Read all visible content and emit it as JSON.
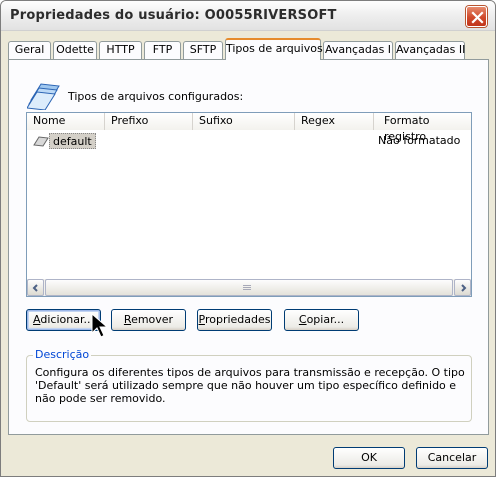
{
  "window": {
    "title": "Propriedades do usuário: O0055RIVERSOFT"
  },
  "tabs": [
    {
      "label": "Geral"
    },
    {
      "label": "Odette"
    },
    {
      "label": "HTTP"
    },
    {
      "label": "FTP"
    },
    {
      "label": "SFTP"
    },
    {
      "label": "Tipos de arquivos"
    },
    {
      "label": "Avançadas I"
    },
    {
      "label": "Avançadas II"
    }
  ],
  "active_tab": "Tipos de arquivos",
  "panel": {
    "header_label": "Tipos de arquivos configurados:",
    "columns": [
      {
        "label": "Nome"
      },
      {
        "label": "Prefixo"
      },
      {
        "label": "Sufixo"
      },
      {
        "label": "Regex"
      },
      {
        "label": "Formato registro"
      }
    ],
    "rows": [
      {
        "name": "default",
        "prefix": "",
        "suffix": "",
        "regex": "",
        "format": "Não formatado"
      }
    ],
    "buttons": {
      "add": {
        "accel": "A",
        "rest": "dicionar..."
      },
      "remove": {
        "accel": "R",
        "rest": "emover"
      },
      "properties": {
        "accel": "P",
        "rest": "ropriedades"
      },
      "copy": {
        "accel": "C",
        "rest": "opiar..."
      }
    },
    "description": {
      "legend": "Descrição",
      "text": "Configura os diferentes tipos de arquivos para transmissão e recepção. O tipo 'Default' será utilizado sempre que não houver um tipo específico definido e não pode ser removido."
    }
  },
  "footer": {
    "ok_label": "OK",
    "cancel_label": "Cancelar"
  },
  "colors": {
    "active_tab_accent": "#e68b2c",
    "legend_text": "#0046d5",
    "close_button": "#d04a2c"
  }
}
